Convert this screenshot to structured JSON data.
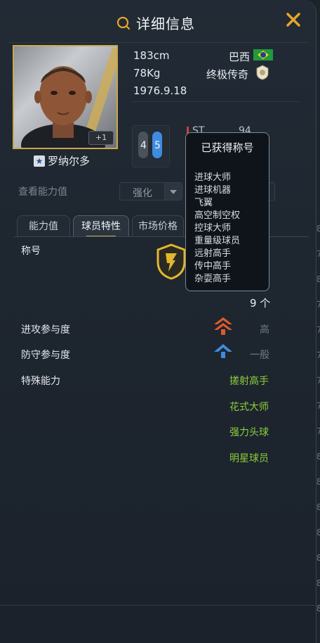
{
  "header": {
    "title": "详细信息"
  },
  "player": {
    "name": "罗纳尔多",
    "height": "183cm",
    "weight": "78Kg",
    "birthday": "1976.9.18",
    "nationality": "巴西",
    "season": "终极传奇",
    "upgrade_badge": "+1",
    "left_foot": "4",
    "right_foot": "5",
    "position": "ST",
    "position_rating": "94"
  },
  "ability": {
    "label": "查看能力值",
    "select_value": "强化"
  },
  "tabs": [
    {
      "label": "能力值"
    },
    {
      "label": "球员特性"
    },
    {
      "label": "市场价格"
    }
  ],
  "traits": {
    "title_label": "称号",
    "title_count": "9 个",
    "attack_label": "进攻参与度",
    "attack_value": "高",
    "defense_label": "防守参与度",
    "defense_value": "一般",
    "special_label": "特殊能力",
    "special_list": [
      "搓射高手",
      "花式大师",
      "强力头球",
      "明星球员"
    ]
  },
  "tooltip": {
    "title": "已获得称号",
    "items": [
      "进球大师",
      "进球机器",
      "飞翼",
      "高空制空权",
      "控球大师",
      "重量级球员",
      "远射高手",
      "传中高手",
      "杂耍高手"
    ]
  },
  "edge_digits": [
    "8",
    "7",
    "8",
    "7",
    "7",
    "7",
    "7",
    "7",
    "7",
    "8",
    "8",
    "8",
    "8",
    "8",
    "8",
    "8",
    "8",
    "8",
    "8",
    "8",
    "8",
    "8",
    "8",
    "8",
    "8",
    "8",
    "8",
    "8",
    "8",
    "8",
    "8",
    "8",
    "8",
    "8",
    "8",
    "8",
    "8",
    "8",
    "8",
    "8",
    "8",
    "8",
    "8",
    "8",
    "8",
    "8",
    "8",
    "8",
    "8",
    "8"
  ],
  "colors": {
    "accent_gold": "#c9a94b",
    "green_text": "#8ccf3a",
    "attack_red": "#e05a2a",
    "defense_blue": "#3f8be0"
  }
}
